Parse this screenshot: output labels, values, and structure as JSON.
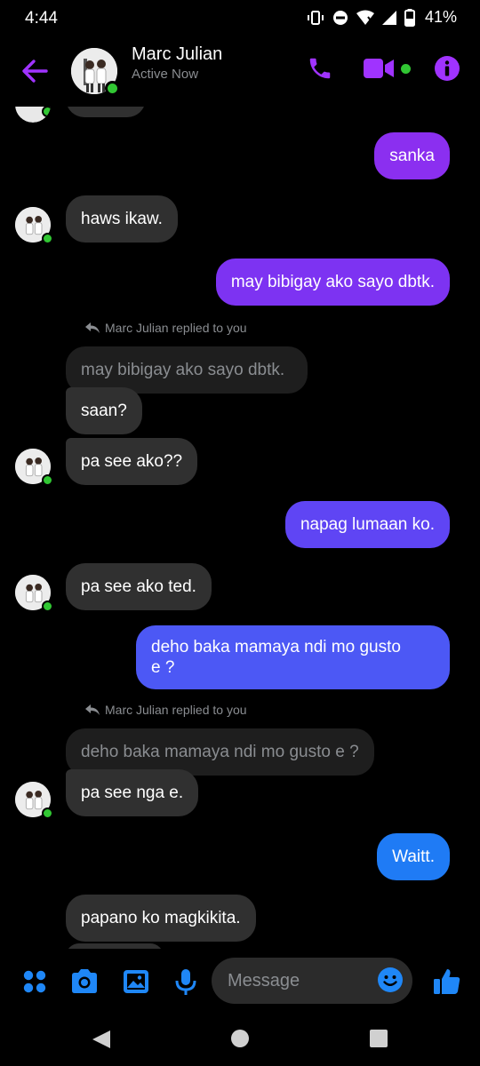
{
  "status_bar": {
    "time": "4:44",
    "battery": "41%"
  },
  "header": {
    "name": "Marc Julian",
    "status": "Active Now"
  },
  "messages": {
    "m1": "sanka",
    "m2": "haws ikaw.",
    "m3": "may bibigay ako sayo dbtk.",
    "reply1_label": "Marc Julian replied to you",
    "quote1": "may bibigay ako sayo dbtk.",
    "m4": "saan?",
    "m5": "pa see ako??",
    "m6": "napag lumaan ko.",
    "m7": "pa see ako ted.",
    "m8_line1": "deho baka mamaya ndi mo gusto",
    "m8_line2": "e ?",
    "reply2_label": "Marc Julian replied to you",
    "quote2": "deho baka mamaya ndi mo gusto e ?",
    "m9": "pa see nga e.",
    "m10": "Waitt.",
    "m11": "papano ko magkikita."
  },
  "composer": {
    "placeholder": "Message"
  },
  "colors": {
    "accent_purple": "#a033ff",
    "bubble_purple": "#8b2ff0",
    "bubble_violet": "#6a3ff3",
    "bubble_indigo": "#4c58f5",
    "bubble_blue": "#1f7bf5",
    "composer_blue": "#1f87f7",
    "incoming": "#303030",
    "online": "#31c733"
  },
  "icons": {
    "header": [
      "back-arrow-icon",
      "phone-icon",
      "video-camera-icon",
      "info-icon"
    ],
    "composer": [
      "apps-grid-icon",
      "camera-icon",
      "gallery-icon",
      "microphone-icon",
      "emoji-icon",
      "thumbs-up-icon"
    ],
    "navbar": [
      "nav-back-icon",
      "nav-home-icon",
      "nav-recents-icon"
    ]
  }
}
